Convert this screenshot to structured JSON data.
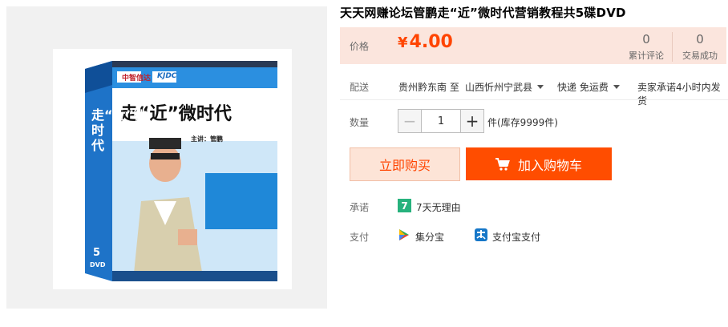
{
  "product": {
    "title": "天天网赚论坛管鹏走“近”微时代营销教程共5碟DVD",
    "box_image": {
      "publisher_logo": "中智信达",
      "series_logo": "KJDC",
      "main_title": "走“近”微时代",
      "spine_title": "走“近”微时代",
      "presenter_line": "主讲：管鹏",
      "disc_count": "5",
      "disc_format": "DVD"
    }
  },
  "price": {
    "label": "价格",
    "currency": "¥",
    "value": "4.00"
  },
  "stats": {
    "reviews": {
      "count": "0",
      "label": "累计评论"
    },
    "trades": {
      "count": "0",
      "label": "交易成功"
    }
  },
  "shipping": {
    "label": "配送",
    "from": "贵州黔东南 至",
    "to": "山西忻州宁武县",
    "method": "快递 免运费",
    "promise": "卖家承诺4小时内发货"
  },
  "quantity": {
    "label": "数量",
    "value": "1",
    "minus": "−",
    "plus": "+",
    "stock": "件(库存9999件)"
  },
  "actions": {
    "buy_now": "立即购买",
    "add_to_cart": "加入购物车"
  },
  "commitment": {
    "label": "承诺",
    "badge": "7",
    "text": "7天无理由"
  },
  "payment": {
    "label": "支付",
    "methods": [
      "集分宝",
      "支付宝支付"
    ]
  },
  "colors": {
    "accent": "#ff4400",
    "price_bg": "#fbe5dd",
    "cart_button": "#ff4d00",
    "badge_green": "#27b27d"
  }
}
